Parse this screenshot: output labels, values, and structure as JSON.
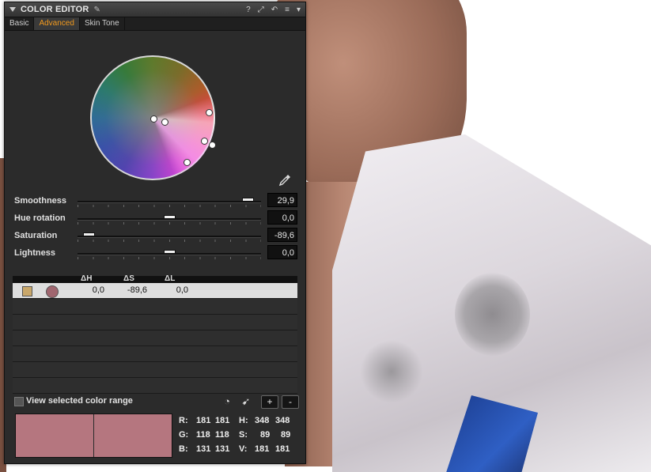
{
  "panel": {
    "title": "COLOR EDITOR",
    "tools": [
      "?",
      "⤢",
      "↶",
      "≡",
      "▾"
    ],
    "tabs": [
      {
        "label": "Basic",
        "active": false
      },
      {
        "label": "Advanced",
        "active": true
      },
      {
        "label": "Skin Tone",
        "active": false
      }
    ]
  },
  "sliders": [
    {
      "label": "Smoothness",
      "value": "29,9",
      "level": 0.96
    },
    {
      "label": "Hue rotation",
      "value": "0,0",
      "level": 0.5
    },
    {
      "label": "Saturation",
      "value": "-89,6",
      "level": 0.03
    },
    {
      "label": "Lightness",
      "value": "0,0",
      "level": 0.5
    }
  ],
  "table": {
    "headers": {
      "dh": "ΔH",
      "ds": "ΔS",
      "dl": "ΔL"
    },
    "rows": [
      {
        "dh": "0,0",
        "ds": "-89,6",
        "dl": "0,0",
        "selected": true
      }
    ]
  },
  "footer": {
    "view_range_label": "View selected color range",
    "plus": "+",
    "minus": "-"
  },
  "readout": {
    "R": {
      "label": "R:",
      "a": "181",
      "b": "181"
    },
    "G": {
      "label": "G:",
      "a": "118",
      "b": "118"
    },
    "B": {
      "label": "B:",
      "a": "131",
      "b": "131"
    },
    "H": {
      "label": "H:",
      "a": "348",
      "b": "348"
    },
    "S": {
      "label": "S:",
      "a": "89",
      "b": "89"
    },
    "V": {
      "label": "V:",
      "a": "181",
      "b": "181"
    }
  },
  "colors": {
    "accent": "#f29a1e",
    "preview": "#b5767f",
    "panel_bg": "#2b2b2b"
  }
}
